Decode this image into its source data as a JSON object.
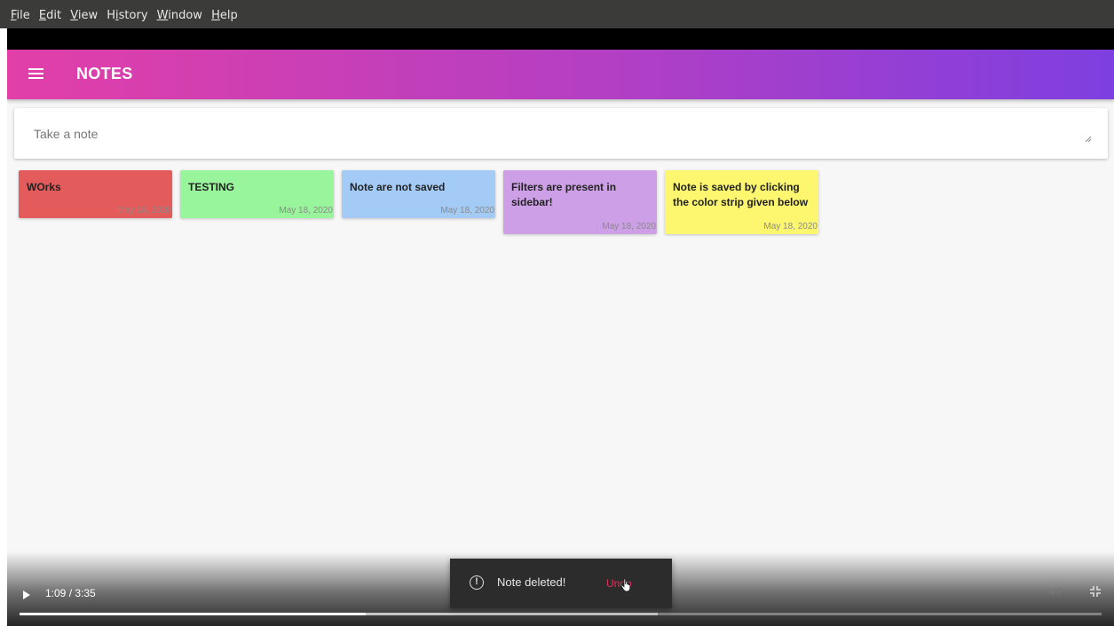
{
  "menubar": {
    "items": [
      {
        "mnemonic": "F",
        "rest": "ile"
      },
      {
        "mnemonic": "E",
        "rest": "dit"
      },
      {
        "mnemonic": "V",
        "rest": "iew"
      },
      {
        "pre": "H",
        "mnemonic": "i",
        "rest": "story"
      },
      {
        "mnemonic": "W",
        "rest": "indow"
      },
      {
        "mnemonic": "H",
        "rest": "elp"
      }
    ]
  },
  "appbar": {
    "title": "NOTES",
    "icon": "menu-icon",
    "gradient_colors": [
      "#e23fa8",
      "#b23fc4",
      "#7e3fe0"
    ]
  },
  "note_input": {
    "placeholder": "Take a note",
    "value": ""
  },
  "notes": [
    {
      "text": "WOrks",
      "date": "May 18, 2020",
      "color": "#e45b5b"
    },
    {
      "text": "TESTING",
      "date": "May 18, 2020",
      "color": "#99f59b"
    },
    {
      "text": "Note are not saved",
      "date": "May 18, 2020",
      "color": "#a3cbf5"
    },
    {
      "text": "Filters are present in sidebar!",
      "date": "May 18, 2020",
      "color": "#cc9fe6"
    },
    {
      "text": "Note is saved by clicking the color strip given below",
      "date": "May 18, 2020",
      "color": "#fcf76e"
    }
  ],
  "video": {
    "time": "1:09 / 3:35",
    "played_fraction": 0.32,
    "buffered_fraction": 0.59
  },
  "snackbar": {
    "message": "Note deleted!",
    "action": "Undo",
    "icon": "alert-circle-icon",
    "action_color": "#e0305a"
  }
}
